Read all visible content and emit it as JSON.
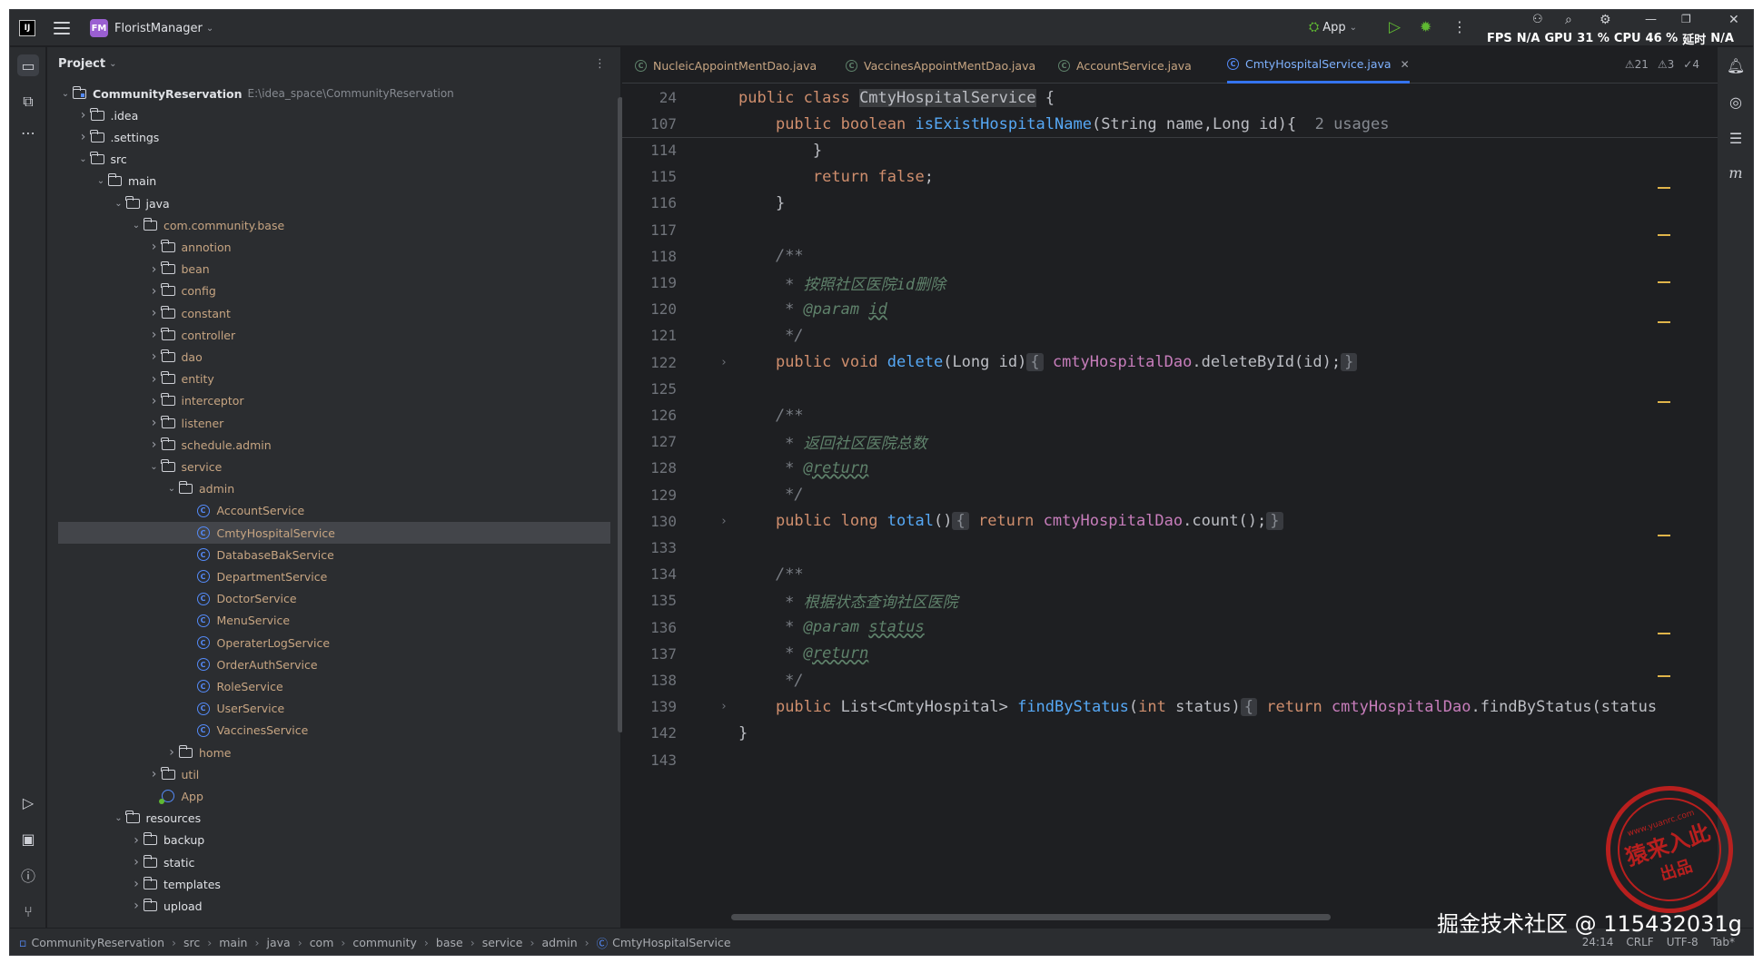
{
  "titlebar": {
    "project_badge": "FM",
    "project_name": "FloristManager",
    "run_config": "App",
    "stats": {
      "fps_label": "FPS",
      "fps": "N/A",
      "gpu_label": "GPU",
      "gpu": "31 %",
      "cpu_label": "CPU",
      "cpu": "46 %",
      "delay_label": "延时",
      "delay": "N/A"
    }
  },
  "project_panel": {
    "title": "Project",
    "tree": [
      {
        "label": "CommunityReservation",
        "path": "E:\\idea_space\\CommunityReservation",
        "depth": 0,
        "arrow": "v",
        "icon": "module",
        "style": "bold"
      },
      {
        "label": ".idea",
        "depth": 1,
        "arrow": ">",
        "icon": "folder"
      },
      {
        "label": ".settings",
        "depth": 1,
        "arrow": ">",
        "icon": "folder"
      },
      {
        "label": "src",
        "depth": 1,
        "arrow": "v",
        "icon": "folder"
      },
      {
        "label": "main",
        "depth": 2,
        "arrow": "v",
        "icon": "folder"
      },
      {
        "label": "java",
        "depth": 3,
        "arrow": "v",
        "icon": "folder"
      },
      {
        "label": "com.community.base",
        "depth": 4,
        "arrow": "v",
        "icon": "folder",
        "style": "pkg"
      },
      {
        "label": "annotion",
        "depth": 5,
        "arrow": ">",
        "icon": "folder",
        "style": "pkg"
      },
      {
        "label": "bean",
        "depth": 5,
        "arrow": ">",
        "icon": "folder",
        "style": "pkg"
      },
      {
        "label": "config",
        "depth": 5,
        "arrow": ">",
        "icon": "folder",
        "style": "pkg"
      },
      {
        "label": "constant",
        "depth": 5,
        "arrow": ">",
        "icon": "folder",
        "style": "pkg"
      },
      {
        "label": "controller",
        "depth": 5,
        "arrow": ">",
        "icon": "folder",
        "style": "pkg"
      },
      {
        "label": "dao",
        "depth": 5,
        "arrow": ">",
        "icon": "folder",
        "style": "pkg"
      },
      {
        "label": "entity",
        "depth": 5,
        "arrow": ">",
        "icon": "folder",
        "style": "pkg"
      },
      {
        "label": "interceptor",
        "depth": 5,
        "arrow": ">",
        "icon": "folder",
        "style": "pkg"
      },
      {
        "label": "listener",
        "depth": 5,
        "arrow": ">",
        "icon": "folder",
        "style": "pkg"
      },
      {
        "label": "schedule.admin",
        "depth": 5,
        "arrow": ">",
        "icon": "folder",
        "style": "pkg"
      },
      {
        "label": "service",
        "depth": 5,
        "arrow": "v",
        "icon": "folder",
        "style": "pkg"
      },
      {
        "label": "admin",
        "depth": 6,
        "arrow": "v",
        "icon": "folder",
        "style": "pkg"
      },
      {
        "label": "AccountService",
        "depth": 7,
        "arrow": "",
        "icon": "class",
        "style": "pkg"
      },
      {
        "label": "CmtyHospitalService",
        "depth": 7,
        "arrow": "",
        "icon": "class",
        "style": "pkg",
        "selected": true
      },
      {
        "label": "DatabaseBakService",
        "depth": 7,
        "arrow": "",
        "icon": "class",
        "style": "pkg"
      },
      {
        "label": "DepartmentService",
        "depth": 7,
        "arrow": "",
        "icon": "class",
        "style": "pkg"
      },
      {
        "label": "DoctorService",
        "depth": 7,
        "arrow": "",
        "icon": "class",
        "style": "pkg"
      },
      {
        "label": "MenuService",
        "depth": 7,
        "arrow": "",
        "icon": "class",
        "style": "pkg"
      },
      {
        "label": "OperaterLogService",
        "depth": 7,
        "arrow": "",
        "icon": "class",
        "style": "pkg"
      },
      {
        "label": "OrderAuthService",
        "depth": 7,
        "arrow": "",
        "icon": "class",
        "style": "pkg"
      },
      {
        "label": "RoleService",
        "depth": 7,
        "arrow": "",
        "icon": "class",
        "style": "pkg"
      },
      {
        "label": "UserService",
        "depth": 7,
        "arrow": "",
        "icon": "class",
        "style": "pkg"
      },
      {
        "label": "VaccinesService",
        "depth": 7,
        "arrow": "",
        "icon": "class",
        "style": "pkg"
      },
      {
        "label": "home",
        "depth": 6,
        "arrow": ">",
        "icon": "folder",
        "style": "pkg"
      },
      {
        "label": "util",
        "depth": 5,
        "arrow": ">",
        "icon": "folder",
        "style": "pkg"
      },
      {
        "label": "App",
        "depth": 5,
        "arrow": "",
        "icon": "app",
        "style": "pkg"
      },
      {
        "label": "resources",
        "depth": 3,
        "arrow": "v",
        "icon": "folder"
      },
      {
        "label": "backup",
        "depth": 4,
        "arrow": ">",
        "icon": "folder"
      },
      {
        "label": "static",
        "depth": 4,
        "arrow": ">",
        "icon": "folder"
      },
      {
        "label": "templates",
        "depth": 4,
        "arrow": ">",
        "icon": "folder"
      },
      {
        "label": "upload",
        "depth": 4,
        "arrow": ">",
        "icon": "folder"
      }
    ]
  },
  "editor": {
    "tabs": [
      {
        "label": "NucleicAppointMentDao.java",
        "active": false
      },
      {
        "label": "VaccinesAppointMentDao.java",
        "active": false
      },
      {
        "label": "AccountService.java",
        "active": false
      },
      {
        "label": "CmtyHospitalService.java",
        "active": true
      }
    ],
    "inspections": {
      "warnings": "21",
      "weak_warnings": "3",
      "checks": "4"
    },
    "sticky_lines": [
      {
        "no": "24",
        "html": "<span class=\"kw\">public class </span><span class=\"cls-hl\">CmtyHospitalService</span> {"
      },
      {
        "no": "107",
        "html": "    <span class=\"kw\">public boolean </span><span class=\"fn\">isExistHospitalName</span>(String name,Long id){  <span class=\"hint\">2 usages</span>"
      }
    ],
    "lines": [
      {
        "no": "114",
        "html": "        }"
      },
      {
        "no": "115",
        "html": "        <span class=\"kw\">return false</span>;"
      },
      {
        "no": "116",
        "html": "    }"
      },
      {
        "no": "117",
        "html": ""
      },
      {
        "no": "118",
        "html": "    <span class=\"cm\">/**</span>"
      },
      {
        "no": "119",
        "html": "<span class=\"cm\">     * </span><span class=\"cmz\">按照社区医院id删除</span>"
      },
      {
        "no": "120",
        "html": "<span class=\"cm\">     * </span><span class=\"tagp\">@param</span> <span class=\"tag\">id</span>"
      },
      {
        "no": "121",
        "html": "<span class=\"cm\">     */</span>"
      },
      {
        "no": "122",
        "html": "    <span class=\"kw\">public void </span><span class=\"fn\">delete</span>(Long id)<span class=\"fbr\">{</span> <span class=\"fd\">cmtyHospitalDao</span>.deleteById(id);<span class=\"fbr\">}</span>",
        "fold": true
      },
      {
        "no": "125",
        "html": ""
      },
      {
        "no": "126",
        "html": "    <span class=\"cm\">/**</span>"
      },
      {
        "no": "127",
        "html": "<span class=\"cm\">     * </span><span class=\"cmz\">返回社区医院总数</span>"
      },
      {
        "no": "128",
        "html": "<span class=\"cm\">     * </span><span class=\"tag\">@return</span>"
      },
      {
        "no": "129",
        "html": "<span class=\"cm\">     */</span>"
      },
      {
        "no": "130",
        "html": "    <span class=\"kw\">public long </span><span class=\"fn\">total</span>()<span class=\"fbr\">{</span> <span class=\"kw\">return </span><span class=\"fd\">cmtyHospitalDao</span>.count();<span class=\"fbr\">}</span>",
        "fold": true
      },
      {
        "no": "133",
        "html": ""
      },
      {
        "no": "134",
        "html": "    <span class=\"cm\">/**</span>"
      },
      {
        "no": "135",
        "html": "<span class=\"cm\">     * </span><span class=\"cmz\">根据状态查询社区医院</span>"
      },
      {
        "no": "136",
        "html": "<span class=\"cm\">     * </span><span class=\"tagp\">@param</span> <span class=\"tag\">status</span>"
      },
      {
        "no": "137",
        "html": "<span class=\"cm\">     * </span><span class=\"tag\">@return</span>"
      },
      {
        "no": "138",
        "html": "<span class=\"cm\">     */</span>"
      },
      {
        "no": "139",
        "html": "    <span class=\"kw\">public </span>List&lt;CmtyHospital&gt; <span class=\"fn\">findByStatus</span>(<span class=\"kw\">int </span>status)<span class=\"fbr\">{</span> <span class=\"kw\">return </span><span class=\"fd\">cmtyHospitalDao</span>.findByStatus(status",
        "fold": true
      },
      {
        "no": "142",
        "html": "}"
      },
      {
        "no": "143",
        "html": ""
      }
    ]
  },
  "statusbar": {
    "breadcrumbs": [
      "CommunityReservation",
      "src",
      "main",
      "java",
      "com",
      "community",
      "base",
      "service",
      "admin",
      "CmtyHospitalService"
    ],
    "position": "24:14",
    "line_sep": "CRLF",
    "encoding": "UTF-8",
    "indent": "Tab*"
  },
  "watermark": {
    "text": "掘金技术社区 @ 115432031g",
    "stamp_main": "猿来入此",
    "stamp_url": "www.yuanrc.com",
    "stamp_sub": "出品"
  }
}
